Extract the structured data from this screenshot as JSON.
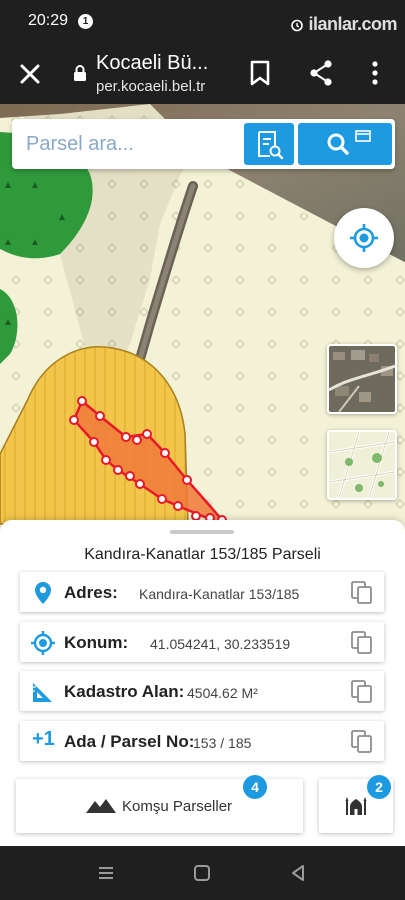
{
  "status_bar": {
    "time": "20:29",
    "notification_count": "1",
    "watermark": "ilanlar.com"
  },
  "browser": {
    "title": "Kocaeli Bü...",
    "url": "per.kocaeli.bel.tr"
  },
  "map": {
    "search_placeholder": "Parsel ara..."
  },
  "parcel": {
    "title": "Kandıra-Kanatlar 153/185 Parseli",
    "rows": [
      {
        "label": "Adres:",
        "value": "Kandıra-Kanatlar 153/185"
      },
      {
        "label": "Konum:",
        "value": "41.054241, 30.233519"
      },
      {
        "label": "Kadastro Alan:",
        "value": "4504.62 M²"
      },
      {
        "prefix": "+1",
        "label": "Ada / Parsel No:",
        "value": "153 / 185"
      }
    ]
  },
  "actions": {
    "komsu_label": "Komşu Parseller",
    "komsu_count": "4",
    "mosque_count": "2"
  },
  "colors": {
    "accent": "#1e9be0",
    "parcel_fill": "#f07a3a",
    "parcel_outline": "#e8192a",
    "field_yellow": "#f2c64a",
    "forest_green": "#2f9a3c"
  },
  "icons": [
    "close-icon",
    "lock-icon",
    "bookmark-icon",
    "share-icon",
    "more-icon",
    "document-search-icon",
    "search-icon",
    "locate-icon",
    "location-pin-icon",
    "crosshair-icon",
    "area-ruler-icon",
    "copy-icon",
    "mountain-icon",
    "mosque-icon"
  ]
}
